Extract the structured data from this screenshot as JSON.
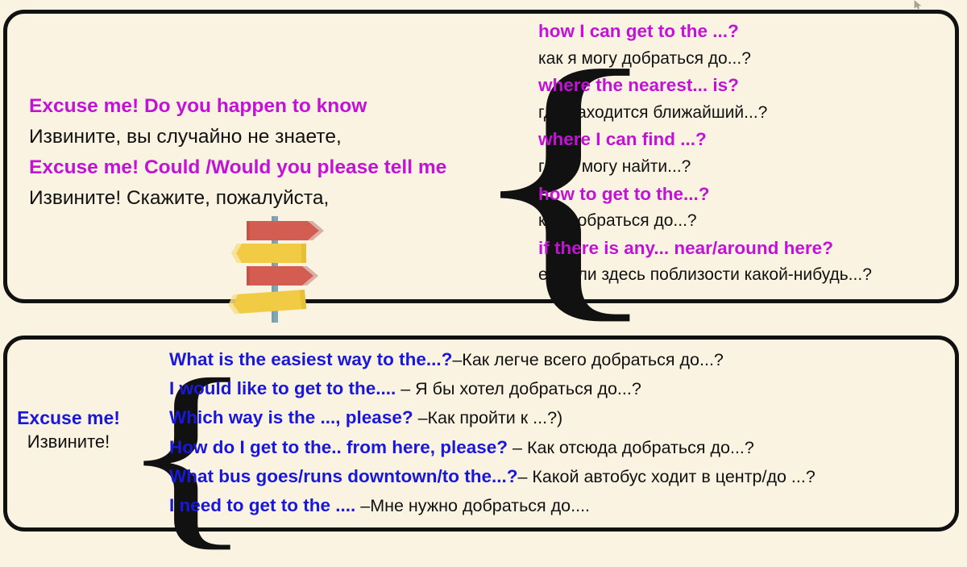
{
  "colors": {
    "background": "#FBF3E2",
    "panel_border": "#111111",
    "english_purple": "#C213D4",
    "english_blue": "#1A18D8",
    "russian_black": "#111111",
    "sign_red": "#D45D52",
    "sign_yellow": "#F0CB43",
    "post_blue": "#7FA7B8"
  },
  "top_panel": {
    "left_column": {
      "lines": [
        {
          "text": "Excuse me! Do you happen to know",
          "lang": "en"
        },
        {
          "text": "Извините, вы случайно не знаете,",
          "lang": "ru"
        },
        {
          "text": "Excuse me! Could /Would you please tell me",
          "lang": "en"
        },
        {
          "text": "Извините! Скажите, пожалуйста,",
          "lang": "ru"
        }
      ]
    },
    "brace_glyph": "{",
    "right_column": {
      "lines": [
        {
          "text": "how I can get to the ...?",
          "lang": "en"
        },
        {
          "text": "как я могу добраться до...?",
          "lang": "ru"
        },
        {
          "text": "where the nearest... is?",
          "lang": "en"
        },
        {
          "text": "где находится ближайший...?",
          "lang": "ru"
        },
        {
          "text": "where I can find ...?",
          "lang": "en"
        },
        {
          "text": "где я могу найти...?",
          "lang": "ru"
        },
        {
          "text": "how to get to the...?",
          "lang": "en"
        },
        {
          "text": "как добраться до...?",
          "lang": "ru"
        },
        {
          "text": "if there is any... near/around here?",
          "lang": "en"
        },
        {
          "text": "есть ли здесь поблизости какой-нибудь...?",
          "lang": "ru"
        }
      ]
    },
    "illustration": {
      "name": "signpost-with-direction-arrows",
      "arrows": [
        {
          "color": "#D45D52",
          "direction": "right"
        },
        {
          "color": "#F0CB43",
          "direction": "left"
        },
        {
          "color": "#D45D52",
          "direction": "right"
        },
        {
          "color": "#F0CB43",
          "direction": "right"
        }
      ]
    }
  },
  "bottom_panel": {
    "label": {
      "english": "Excuse me!",
      "russian": "Извините!"
    },
    "brace_glyph": "{",
    "rows": [
      {
        "english": "What is the easiest way to the...?",
        "russian": "–Как легче всего добраться до...?"
      },
      {
        "english": "I would like to get to the....",
        "russian": " – Я бы хотел добраться до...?"
      },
      {
        "english": "Which way is the ..., please?",
        "russian": " –Как пройти к ...?)"
      },
      {
        "english": "How do I get to the.. from here, please?",
        "russian": " – Как отсюда добраться до...?"
      },
      {
        "english": "What bus goes/runs downtown/to the...?",
        "russian": "– Какой автобус ходит в центр/до ...?"
      },
      {
        "english": "I need to get to the ....",
        "russian": " –Мне нужно добраться до...."
      }
    ]
  }
}
